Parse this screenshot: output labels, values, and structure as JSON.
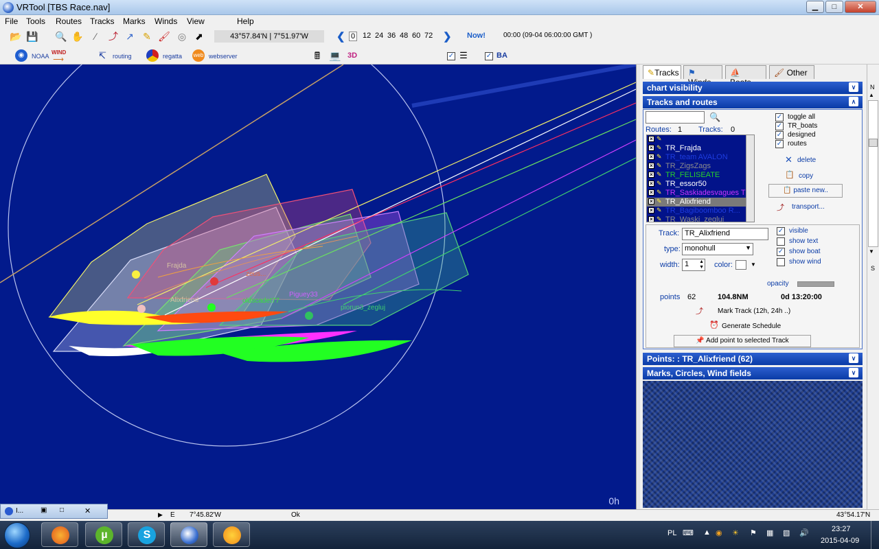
{
  "window": {
    "title": "VRTool [TBS Race.nav]",
    "min": "▁",
    "max": "□",
    "close": "✕"
  },
  "menu": [
    "File",
    "Tools",
    "Routes",
    "Tracks",
    "Marks",
    "Winds",
    "View",
    "Help"
  ],
  "toolbar": {
    "coords": "43°57.84'N | 7°51.97'W",
    "hours": [
      "0",
      "12",
      "24",
      "36",
      "48",
      "60",
      "72"
    ],
    "selected_hour": "0",
    "now": "Now!",
    "timestamp": "00:00 (09-04 06:00:00 GMT )",
    "row2": {
      "noaa": "NOAA",
      "wind": "WIND",
      "routing": "routing",
      "regatta": "regatta",
      "web": "web",
      "webserver": "webserver",
      "three_d": "3D",
      "ba": "BA"
    }
  },
  "chart": {
    "labels": [
      "Frajda",
      "Alixfriend",
      "zeus...",
      "oldscadet77",
      "Piguey33",
      "piorun3_zegluj"
    ],
    "hours_label": "0h"
  },
  "panel": {
    "tabs": [
      "Tracks",
      "Winds",
      "Boats",
      "Other"
    ],
    "chart_visibility": "chart visibility",
    "tracks_and_routes": "Tracks and routes",
    "routes_label": "Routes:",
    "routes_count": "1",
    "tracks_label": "Tracks:",
    "tracks_count": "0",
    "track_items": [
      {
        "name": "",
        "color": "#ffffff"
      },
      {
        "name": "TR_Frajda",
        "color": "#ffffff"
      },
      {
        "name": "TR_team AVALON",
        "color": "#1e3ce0"
      },
      {
        "name": "TR_ZigsZags",
        "color": "#8c8c8c"
      },
      {
        "name": "TR_FELISEATE",
        "color": "#28d02a"
      },
      {
        "name": "TR_essor50",
        "color": "#ffffff"
      },
      {
        "name": "TR_Saskiadesvagues T",
        "color": "#cc33ff"
      },
      {
        "name": "TR_Alixfriend",
        "color": "#ffffff"
      },
      {
        "name": "TR_Bagiboomboo R...",
        "color": "#1e3ce0"
      },
      {
        "name": "TR_Waski_zeglui",
        "color": "#8c8c8c"
      }
    ],
    "selected_index": 7,
    "toggles": [
      "toggle all",
      "TR_boats",
      "designed",
      "routes"
    ],
    "actions": {
      "delete": "delete",
      "copy": "copy",
      "paste": "paste new..",
      "transport": "transport..."
    },
    "track_label": "Track:",
    "track_value": "TR_Alixfriend",
    "type_label": "type:",
    "type_value": "monohull",
    "width_label": "width:",
    "width_value": "1",
    "color_label": "color:",
    "visible": "visible",
    "show_text": "show text",
    "show_boat": "show boat",
    "show_wind": "show wind",
    "opacity": "opacity",
    "points_label": "points",
    "points_value": "62",
    "distance": "104.8NM",
    "duration": "0d 13:20:00",
    "mark_track": "Mark Track (12h, 24h ..)",
    "generate_schedule": "Generate Schedule",
    "add_point": "Add point to selected Track",
    "points_header": "Points: : TR_Alixfriend (62)",
    "marks_header": "Marks, Circles, Wind fields"
  },
  "right_scroll": {
    "n": "N",
    "s": "S"
  },
  "status": {
    "e": "E",
    "lon": "7°45.82'W",
    "ok": "Ok",
    "lat": "43°54.17'N"
  },
  "miniwin": {
    "label": "I..."
  },
  "taskbar": {
    "lang": "PL",
    "time": "23:27",
    "date": "2015-04-09"
  }
}
